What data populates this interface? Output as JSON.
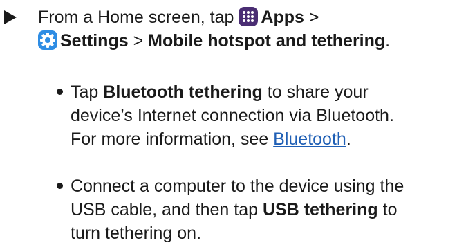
{
  "step": {
    "text_1": "From a Home screen, tap",
    "apps_icon": "apps-grid-icon",
    "apps_label": "Apps",
    "separator_1": ">",
    "settings_icon": "gear-icon",
    "settings_label": "Settings",
    "separator_2": ">",
    "hotspot_label": "Mobile hotspot and tethering",
    "end": "."
  },
  "bullets": [
    {
      "pre": "Tap",
      "bold": "Bluetooth tethering",
      "line1_rest": "to share your",
      "line2": "device’s Internet connection via Bluetooth.",
      "line3_pre": "For more information, see",
      "link": "Bluetooth",
      "line3_end": "."
    },
    {
      "line1": "Connect a computer to the device using the",
      "line2_pre": "USB cable, and then tap",
      "bold": "USB tethering",
      "line2_post": "to",
      "line3": "turn tethering on."
    }
  ],
  "colors": {
    "text": "#1a1a1a",
    "link": "#1f5fb5",
    "apps_icon_bg": "#4a2d73",
    "settings_icon_bg": "#2f8de4"
  }
}
